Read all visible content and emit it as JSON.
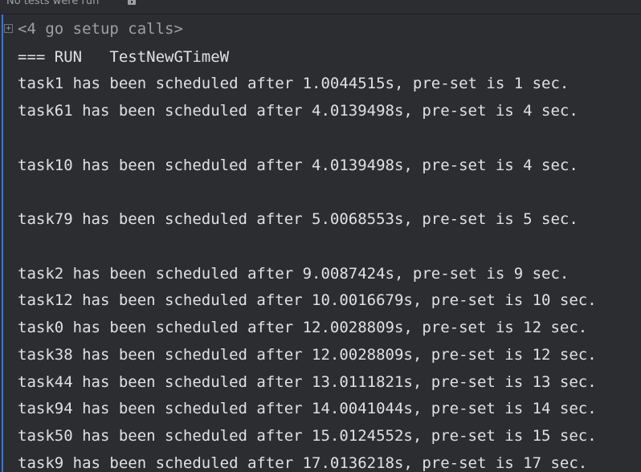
{
  "status_bar": {
    "text": "No tests were run"
  },
  "console": {
    "setup_calls": "<4 go setup calls>",
    "run_header": "=== RUN   TestNewGTimeW",
    "lines": [
      "task1 has been scheduled after 1.0044515s, pre-set is 1 sec.",
      "task61 has been scheduled after 4.0139498s, pre-set is 4 sec.",
      "",
      "task10 has been scheduled after 4.0139498s, pre-set is 4 sec.",
      "",
      "task79 has been scheduled after 5.0068553s, pre-set is 5 sec.",
      "",
      "task2 has been scheduled after 9.0087424s, pre-set is 9 sec.",
      "task12 has been scheduled after 10.0016679s, pre-set is 10 sec.",
      "task0 has been scheduled after 12.0028809s, pre-set is 12 sec.",
      "task38 has been scheduled after 12.0028809s, pre-set is 12 sec.",
      "task44 has been scheduled after 13.0111821s, pre-set is 13 sec.",
      "task94 has been scheduled after 14.0041044s, pre-set is 14 sec.",
      "task50 has been scheduled after 15.0124552s, pre-set is 15 sec.",
      "task9 has been scheduled after 17.0136218s, pre-set is 17 sec."
    ]
  },
  "icons": {
    "lock": "lock-icon",
    "fold": "fold-expand-icon"
  },
  "colors": {
    "background": "#2b2d30",
    "text": "#dfe1e5",
    "muted_text": "#9da0a8",
    "gutter_accent": "#3574f0"
  }
}
